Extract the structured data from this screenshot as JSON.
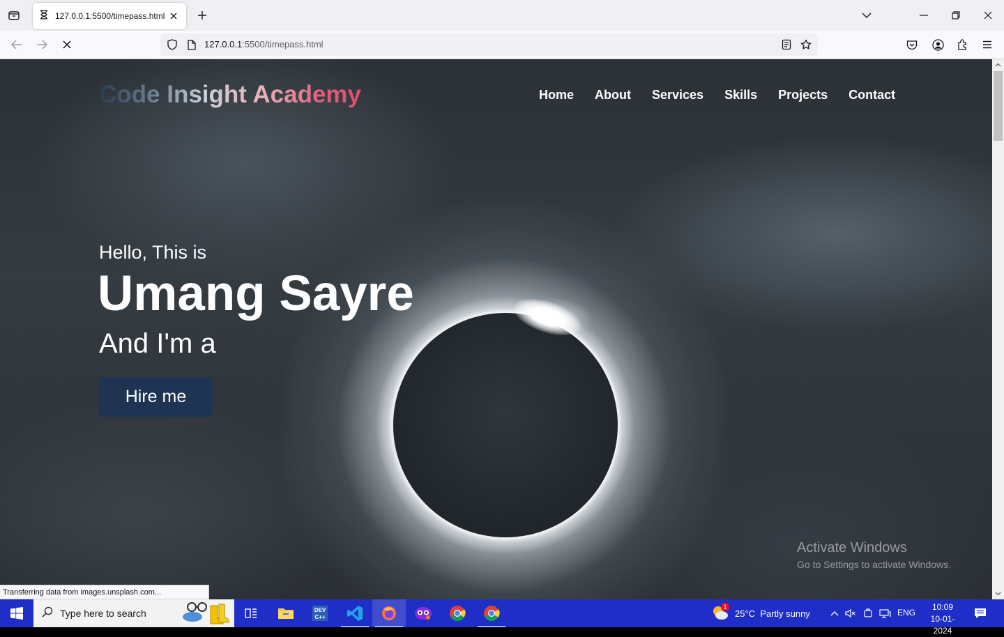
{
  "browser": {
    "tab_title": "127.0.0.1:5500/timepass.html",
    "url_host": "127.0.0.1",
    "url_path": ":5500/timepass.html",
    "status_text": "Transferring data from images.unsplash.com..."
  },
  "site": {
    "logo": "Code Insight Academy",
    "nav": [
      "Home",
      "About",
      "Services",
      "Skills",
      "Projects",
      "Contact"
    ],
    "hero": {
      "greeting": "Hello, This is",
      "name": "Umang Sayre",
      "role": "And I'm a",
      "cta": "Hire me"
    }
  },
  "watermark": {
    "title": "Activate Windows",
    "subtitle": "Go to Settings to activate Windows."
  },
  "taskbar": {
    "search_placeholder": "Type here to search",
    "weather": "25°C  Partly sunny",
    "weather_badge": "1",
    "language": "ENG",
    "time": "10:09",
    "date": "10-01-2024"
  },
  "colors": {
    "taskbar": "#1f2ec7",
    "hire_button": "#1f3452",
    "logo_accent": "#e0607a"
  }
}
